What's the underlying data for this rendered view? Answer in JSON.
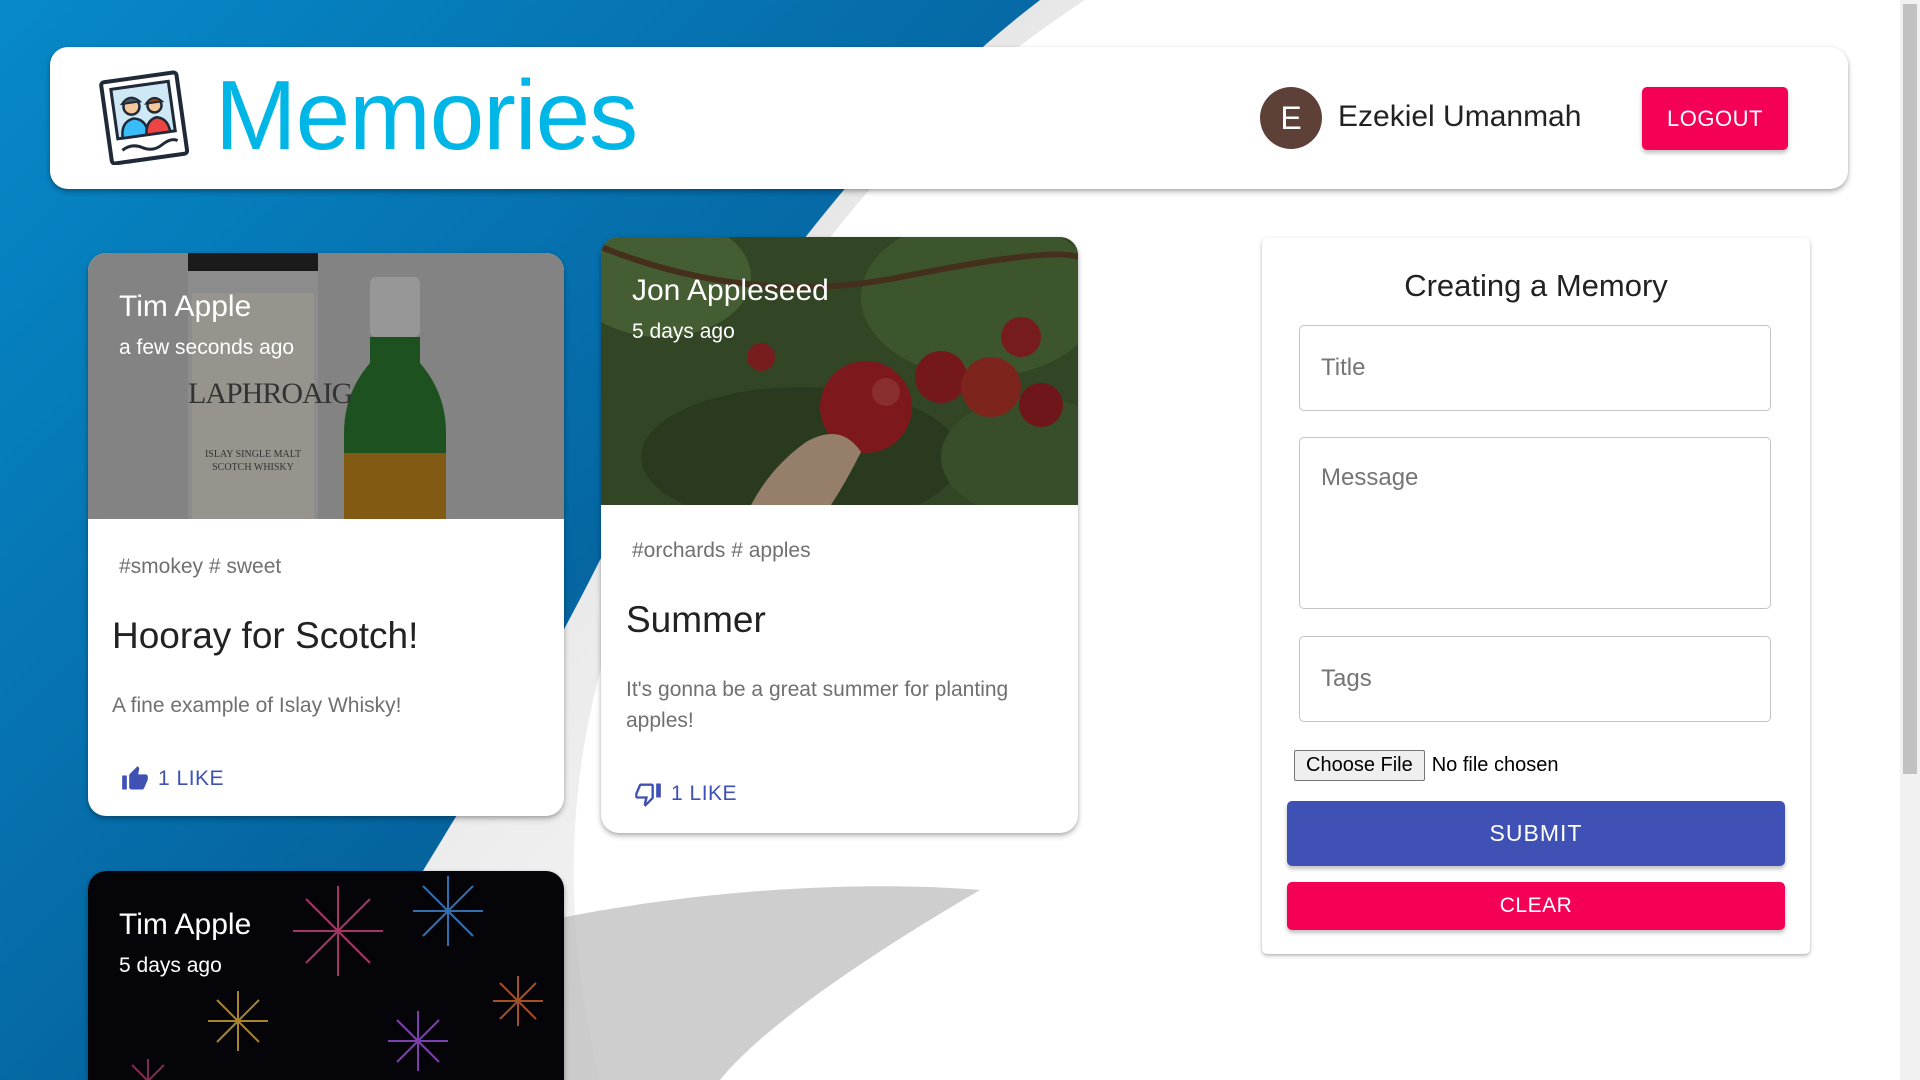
{
  "header": {
    "brand_title": "Memories",
    "logo_icon": "photo-frame-icon",
    "user": {
      "avatar_initial": "E",
      "name": "Ezekiel Umanmah",
      "avatar_color": "#5d4037"
    },
    "logout_label": "LOGOUT"
  },
  "posts": [
    {
      "author": "Tim Apple",
      "time": "a few seconds ago",
      "tags": "#smokey # sweet",
      "title": "Hooray for Scotch!",
      "message": "A fine example of Islay Whisky!",
      "like_label": "1 LIKE",
      "like_icon": "thumb-up-filled-icon",
      "image_label_brand": "LAPHROAIG",
      "image_label_sub1": "ISLAY SINGLE MALT",
      "image_label_sub2": "SCOTCH WHISKY"
    },
    {
      "author": "Jon Appleseed",
      "time": "5 days ago",
      "tags": "#orchards # apples",
      "title": "Summer",
      "message": "It's gonna be a great summer for planting apples!",
      "like_label": "1 LIKE",
      "like_icon": "thumb-down-outline-icon"
    },
    {
      "author": "Tim Apple",
      "time": "5 days ago"
    }
  ],
  "form": {
    "title": "Creating a Memory",
    "title_placeholder": "Title",
    "message_placeholder": "Message",
    "tags_placeholder": "Tags",
    "choose_file_label": "Choose File",
    "no_file_text": "No file chosen",
    "submit_label": "SUBMIT",
    "clear_label": "CLEAR"
  },
  "colors": {
    "brand": "#00b6e6",
    "primary": "#3f51b5",
    "secondary": "#f50057",
    "background_blue": "#0a6ba8"
  }
}
